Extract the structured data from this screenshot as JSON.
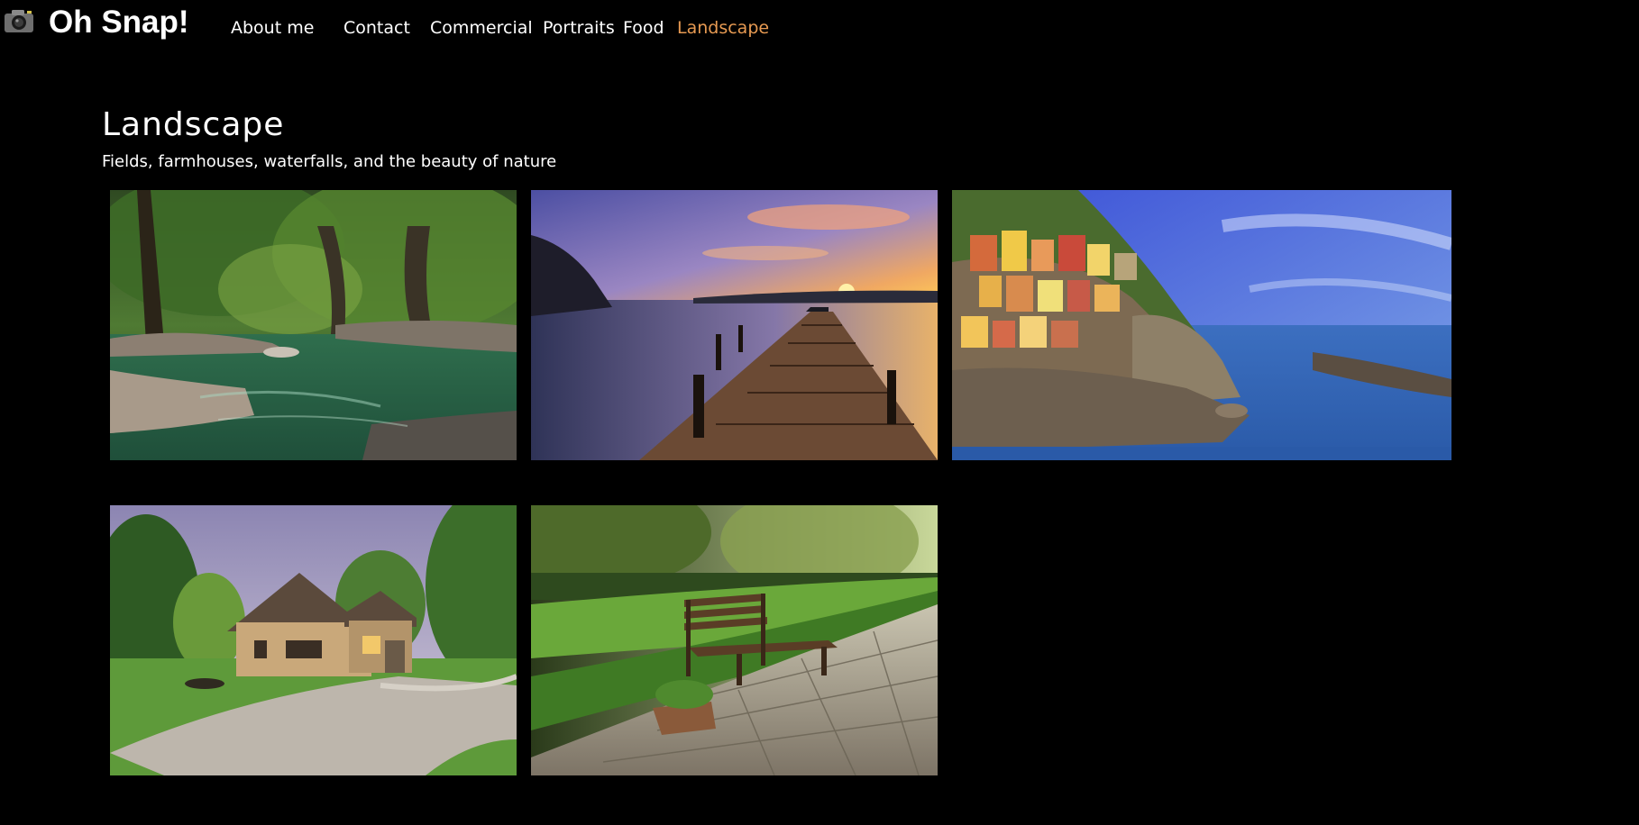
{
  "header": {
    "brand": "Oh Snap!",
    "logo_icon": "camera-icon",
    "nav": [
      {
        "label": "About me",
        "active": false
      },
      {
        "label": "Contact",
        "active": false
      },
      {
        "label": "Commercial",
        "active": false
      },
      {
        "label": "Portraits",
        "active": false
      },
      {
        "label": "Food",
        "active": false
      },
      {
        "label": "Landscape",
        "active": true
      }
    ],
    "active_color": "#e79a52"
  },
  "page": {
    "title": "Landscape",
    "subtitle": "Fields, farmhouses, waterfalls, and the beauty of nature"
  },
  "gallery": {
    "photos": [
      {
        "subject": "forest-river"
      },
      {
        "subject": "lake-pier-sunset"
      },
      {
        "subject": "cliffside-village"
      },
      {
        "subject": "country-house"
      },
      {
        "subject": "park-bench"
      }
    ]
  }
}
